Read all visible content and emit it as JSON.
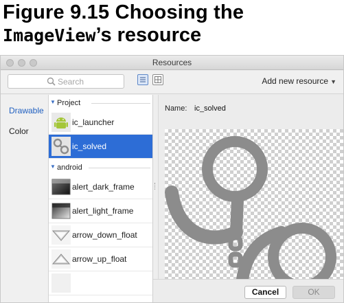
{
  "figure": {
    "line1": "Figure 9.15  Choosing the",
    "line2_code": "ImageView",
    "line2_rest": "’s resource"
  },
  "window": {
    "title": "Resources"
  },
  "toolbar": {
    "search_placeholder": "Search",
    "view_modes": [
      "list-view-icon",
      "grid-view-icon"
    ],
    "active_view": "list",
    "add_new_resource": "Add new resource"
  },
  "categories": [
    {
      "label": "Drawable",
      "selected": true
    },
    {
      "label": "Color",
      "selected": false
    }
  ],
  "groups": [
    {
      "name": "Project",
      "items": [
        {
          "label": "ic_launcher",
          "icon": "android-launcher-icon",
          "selected": false
        },
        {
          "label": "ic_solved",
          "icon": "handcuffs-icon",
          "selected": true
        }
      ]
    },
    {
      "name": "android",
      "items": [
        {
          "label": "alert_dark_frame",
          "icon": "dark-frame-icon",
          "selected": false
        },
        {
          "label": "alert_light_frame",
          "icon": "light-frame-icon",
          "selected": false
        },
        {
          "label": "arrow_down_float",
          "icon": "arrow-down-icon",
          "selected": false
        },
        {
          "label": "arrow_up_float",
          "icon": "arrow-up-icon",
          "selected": false
        }
      ]
    }
  ],
  "detail": {
    "name_label": "Name:",
    "name_value": "ic_solved",
    "preview_icon": "handcuffs-icon"
  },
  "buttons": {
    "cancel": "Cancel",
    "ok": "OK"
  },
  "colors": {
    "selection": "#2d6dd6",
    "category_selected": "#1f5fc0",
    "android_green": "#a4c639",
    "preview_gray": "#8c8c8c"
  }
}
